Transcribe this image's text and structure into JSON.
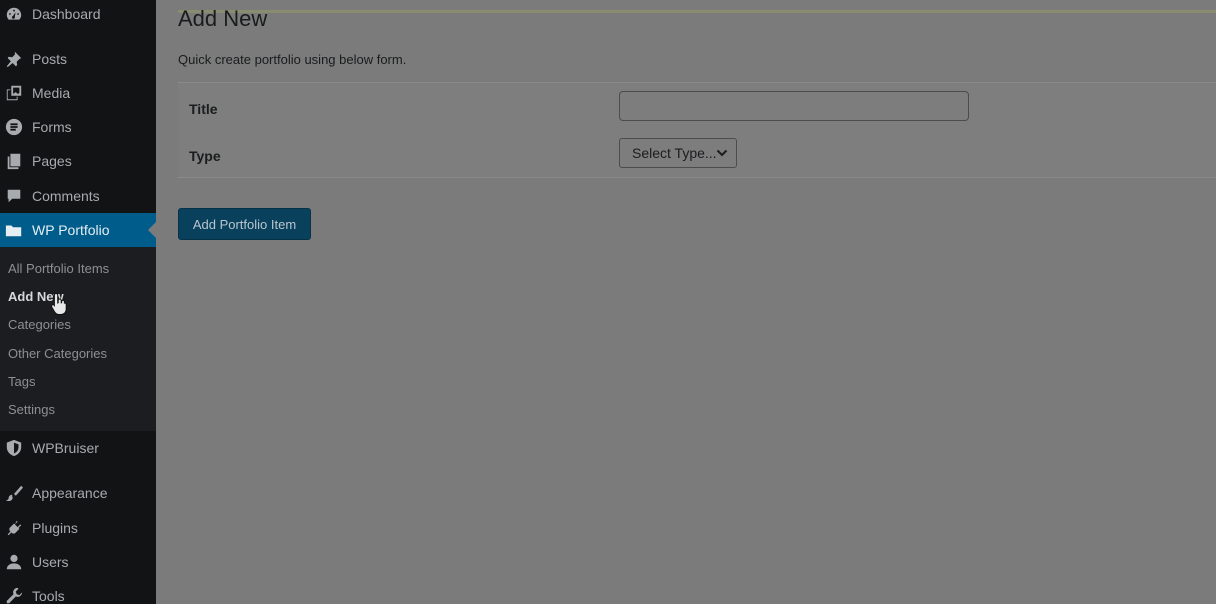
{
  "sidebar": {
    "top_items": [
      {
        "label": "Dashboard",
        "icon": "dashboard-icon"
      },
      {
        "label": "Posts",
        "icon": "pin-icon"
      },
      {
        "label": "Media",
        "icon": "media-icon"
      },
      {
        "label": "Forms",
        "icon": "forms-icon"
      },
      {
        "label": "Pages",
        "icon": "pages-icon"
      },
      {
        "label": "Comments",
        "icon": "comment-icon"
      },
      {
        "label": "WP Portfolio",
        "icon": "folder-icon"
      }
    ],
    "submenu": [
      {
        "label": "All Portfolio Items"
      },
      {
        "label": "Add New"
      },
      {
        "label": "Categories"
      },
      {
        "label": "Other Categories"
      },
      {
        "label": "Tags"
      },
      {
        "label": "Settings"
      }
    ],
    "bottom_items": [
      {
        "label": "WPBruiser",
        "icon": "shield-icon"
      },
      {
        "label": "Appearance",
        "icon": "brush-icon"
      },
      {
        "label": "Plugins",
        "icon": "plug-icon"
      },
      {
        "label": "Users",
        "icon": "user-icon"
      },
      {
        "label": "Tools",
        "icon": "wrench-icon"
      }
    ]
  },
  "main": {
    "title": "Add New",
    "description": "Quick create portfolio using below form.",
    "form": {
      "title_label": "Title",
      "title_value": "",
      "type_label": "Type",
      "type_selected": "Select Type..."
    },
    "submit_label": "Add Portfolio Item"
  },
  "colors": {
    "sidebar_bg": "#111315",
    "current_menu": "#005d8b",
    "button": "#09405c",
    "overlay": "#7b7b7b"
  }
}
